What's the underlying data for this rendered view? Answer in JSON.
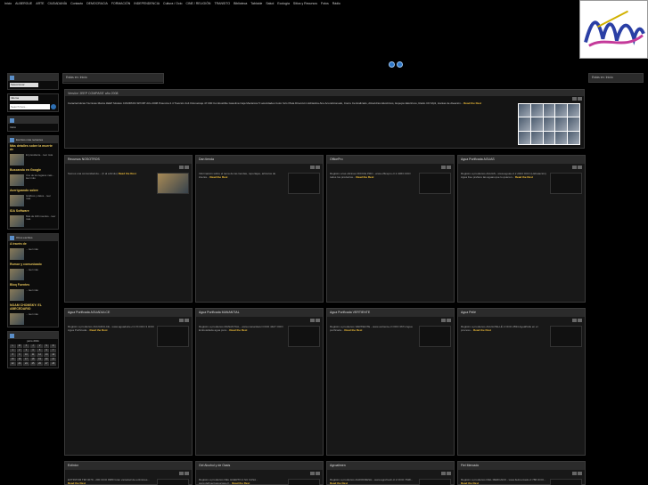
{
  "topnav": [
    "Inicio",
    "ALBERGUE",
    "ARTE",
    "CIUDADANÍA",
    "Contacto",
    "DEMOCRACIA",
    "FORMACIÓN",
    "INDEPENDENCIA",
    "Cultura / Ocio",
    "CINE / RELIGIÓN",
    "TRANSITO",
    "Biblioteca",
    "Tabloide",
    "Salud",
    "Ecología",
    "Sitios y Recursos",
    "Fotos",
    "Rádio"
  ],
  "social": [
    "twitter-icon",
    "facebook-icon"
  ],
  "breadcrumb": "Estás en: Inicio",
  "left_sidebar": {
    "select_value": "Seleccionar",
    "select2_value": "Idioma",
    "search_placeholder": "Search here...",
    "section1": "Inicio",
    "recent_header": "Escritos más recientes",
    "recent_posts": [
      {
        "title": "Más detalles sobre la muerte de",
        "text": "El presidente... leer más"
      },
      {
        "title": "Buscando en Google",
        "text": "Uno de los lugares más... leer más"
      },
      {
        "title": "Averiguando sobre",
        "text": "Gráficos y datos... leer más"
      },
      {
        "title": "IDA Software",
        "text": "Más de 100 muertos... leer más"
      }
    ],
    "more_header": "Otros escritos",
    "more_posts": [
      {
        "title": "A través de",
        "text": "... leer más"
      },
      {
        "title": "Rumor y comunicado",
        "text": "... leer más"
      },
      {
        "title": "Bloq Fuentes",
        "text": "... leer más"
      },
      {
        "title": "NOAM CHOMSKY: EL ABECEDARIO",
        "text": "... leer más"
      }
    ],
    "calendar_title": "junio 2011",
    "calendar_days": [
      "L",
      "M",
      "X",
      "J",
      "V",
      "S",
      "D",
      "1",
      "2",
      "3",
      "4",
      "5",
      "6",
      "7",
      "8",
      "9",
      "10",
      "11",
      "12",
      "13",
      "14",
      "15",
      "16",
      "17",
      "18",
      "19",
      "20",
      "21",
      "22",
      "23",
      "24",
      "25",
      "26",
      "27",
      "28"
    ]
  },
  "feature": {
    "title": "Versión 'JEEP COMPASS' año 2008",
    "text": "Características Técnicas Marca JEEP Modelo COMPASS SPORT Año 2008 Potencia 2.4 Tracción 4x4 Kilometraje 47.000 Combustible Gasolina Caja Mecánica 5 velocidades Color Gris Plata Dirección Hidráulica Aire Acondicionado, Cierre Centralizado, Alzavidrios Eléctricos, Espejos Eléctricos, Radio CD Mp3, Llantas de Aleación...",
    "read_more": "Read the Rest"
  },
  "cards": [
    {
      "title": "Recursos NOSOTROS",
      "text": "Somos una comunidad de... (Ir al artículo)",
      "read_more": "Read the Rest",
      "has_image": true
    },
    {
      "title": "Dan tienda",
      "text": "Información sobre el tema de las tiendas, reportajes, artículos de interés...",
      "read_more": "Read the Rest",
      "has_image": false
    },
    {
      "title": "OfficePro",
      "text": "Registro a las oficinas OFFICE PRO - www.officepro.cl 2 4063 OOO todos los productos...",
      "read_more": "Read the Rest",
      "has_image": false
    },
    {
      "title": "Agua Purificada AGUAS",
      "text": "Registro a productos AGUAS - www.aguas.cl 2 2043 OOO (Hidratación) Agua free prefiere las aguas que lo quieren...",
      "read_more": "Read the Rest",
      "has_image": false
    },
    {
      "title": "Agua Purificada AGUADULCE",
      "text": "Registro a productos AGUADULCE - www.aguadulce.cl 2 8 OOO 3 OOO Agua Purificada...",
      "read_more": "Read the Rest",
      "has_image": false
    },
    {
      "title": "Agua Purificada MANANTIAL",
      "text": "Registro a productos MANANTIAL - www.manantial.cl OOO 4427 OOO Embotellada agua pura...",
      "read_more": "Read the Rest",
      "has_image": false
    },
    {
      "title": "Agua Purificada VERTIENTE",
      "text": "Registro a productos VERTIENTE - www.vertiente.cl OOO 3671 Agua purificada...",
      "read_more": "Read the Rest",
      "has_image": false
    },
    {
      "title": "Agua Pellé",
      "text": "Registro a productos AGUA PELLÉ 2 OOO 2834 AguaPelle en el proceso...",
      "read_more": "Read the Rest",
      "has_image": false
    },
    {
      "title": "Extintor",
      "text": "EXTINTOR TIM 4079 - 200 OOO 9980 Gran variedad de extintores...",
      "read_more": "Read the Rest",
      "has_image": false
    },
    {
      "title": "Gel Alcohol y de Oasis",
      "text": "Registro a productos DEL HUERTO A SU CASA - www.delhuertoasucasa.cl...",
      "read_more": "Read the Rest",
      "has_image": false
    },
    {
      "title": "Agroalimen",
      "text": "Registro a productos AGROFRESH - www.agrofresh.cl 2 OOO 7638...",
      "read_more": "Read the Rest",
      "has_image": false
    },
    {
      "title": "Fiel Mercado",
      "text": "Registro a productos FIEL MERCADO - www.fielmercado.cl 788 OOO...",
      "read_more": "Read the Rest",
      "has_image": false
    }
  ],
  "right_sidebar": {
    "header": "Estás en: Inicio"
  }
}
